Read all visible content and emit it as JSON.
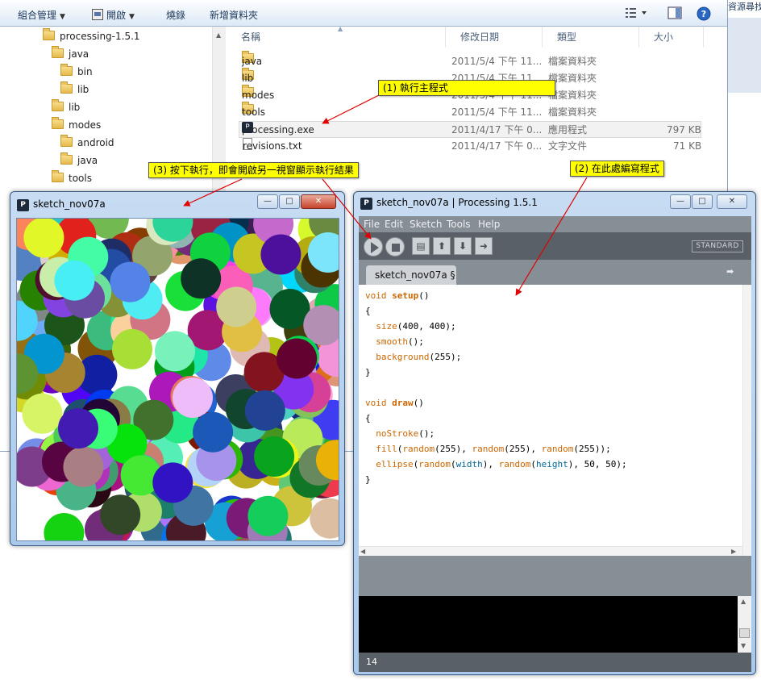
{
  "explorer": {
    "toolbar": {
      "organize": "組合管理",
      "open": "開啟",
      "burn": "燒錄",
      "new_folder": "新增資料夾"
    },
    "tree": [
      {
        "label": "processing-1.5.1",
        "level": 0
      },
      {
        "label": "java",
        "level": 1
      },
      {
        "label": "bin",
        "level": 2
      },
      {
        "label": "lib",
        "level": 2
      },
      {
        "label": "lib",
        "level": 1
      },
      {
        "label": "modes",
        "level": 1
      },
      {
        "label": "android",
        "level": 2
      },
      {
        "label": "java",
        "level": 2
      },
      {
        "label": "tools",
        "level": 1
      }
    ],
    "columns": {
      "name": "名稱",
      "date": "修改日期",
      "type": "類型",
      "size": "大小"
    },
    "files": [
      {
        "name": "java",
        "date": "2011/5/4 下午 11...",
        "type": "檔案資料夾",
        "size": "",
        "icon": "folder-icon"
      },
      {
        "name": "lib",
        "date": "2011/5/4 下午 11...",
        "type": "檔案資料夾",
        "size": "",
        "icon": "folder-icon"
      },
      {
        "name": "modes",
        "date": "2011/5/4 下午 11...",
        "type": "檔案資料夾",
        "size": "",
        "icon": "folder-icon"
      },
      {
        "name": "tools",
        "date": "2011/5/4 下午 11...",
        "type": "檔案資料夾",
        "size": "",
        "icon": "folder-icon"
      },
      {
        "name": "processing.exe",
        "date": "2011/4/17 下午 0...",
        "type": "應用程式",
        "size": "797 KB",
        "icon": "exe-icon"
      },
      {
        "name": "revisions.txt",
        "date": "2011/4/17 下午 0...",
        "type": "文字文件",
        "size": "71 KB",
        "icon": "text-file-icon"
      }
    ],
    "right_edge_text": "資源尋找"
  },
  "sketch_window": {
    "title": "sketch_nov07a",
    "app_icon": "P",
    "buttons": {
      "minimize": "—",
      "maximize": "□",
      "close": "✕"
    }
  },
  "ide": {
    "title": "sketch_nov07a | Processing 1.5.1",
    "app_icon": "P",
    "buttons": {
      "minimize": "—",
      "maximize": "□",
      "close": "✕"
    },
    "menu": [
      "File",
      "Edit",
      "Sketch",
      "Tools",
      "Help"
    ],
    "mode": "STANDARD",
    "tab": "sketch_nov07a §",
    "code": {
      "l1a": "void",
      "l1b": "setup",
      "l1c": "()",
      "l2": "{",
      "l3a": "size",
      "l3b": "(400, 400);",
      "l4a": "smooth",
      "l4b": "();",
      "l5a": "background",
      "l5b": "(255);",
      "l6": "}",
      "l8a": "void",
      "l8b": "draw",
      "l8c": "()",
      "l9": "{",
      "l10a": "noStroke",
      "l10b": "();",
      "l11a": "fill",
      "l11b": "(",
      "l11c": "random",
      "l11d": "(255), ",
      "l11e": "random",
      "l11f": "(255), ",
      "l11g": "random",
      "l11h": "(255));",
      "l12a": "ellipse",
      "l12b": "(",
      "l12c": "random",
      "l12d": "(",
      "l12e": "width",
      "l12f": "), ",
      "l12g": "random",
      "l12h": "(",
      "l12i": "height",
      "l12j": "), 50, 50);",
      "l13": "}"
    },
    "status_line": "14"
  },
  "annotations": {
    "step1": "(1) 執行主程式",
    "step2": "(2) 在此處編寫程式",
    "step3": "(3) 按下執行，即會開啟另一視窗顯示執行結果"
  },
  "colors": {
    "callout": "#ffff00",
    "arrow": "#e00000",
    "keyword": "#cc6600",
    "builtin_variable": "#006699"
  }
}
